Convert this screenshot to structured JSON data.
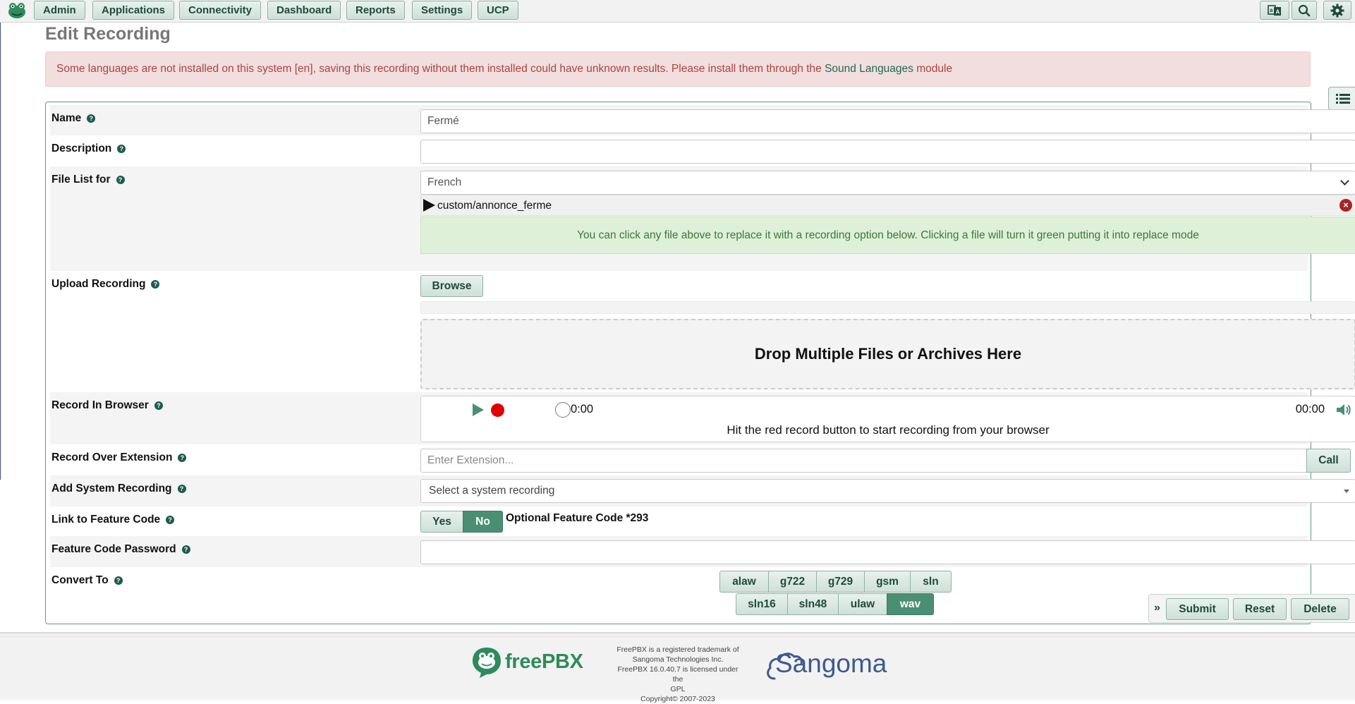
{
  "nav": {
    "items": [
      "Admin",
      "Applications",
      "Connectivity",
      "Dashboard",
      "Reports",
      "Settings",
      "UCP"
    ]
  },
  "icons": {
    "logo": "frog-logo-icon",
    "language": "language-icon",
    "search": "search-icon",
    "settings": "gear-icon",
    "sidebar": "list-icon",
    "help": "question-circle-icon",
    "play": "play-icon",
    "record": "record-icon",
    "volume": "volume-icon",
    "remove": "close-circle-icon"
  },
  "colors": {
    "accent": "#4a8f73",
    "alert_bg": "#f2dede",
    "alert_text": "#a94442",
    "info_bg": "#dff0d8",
    "info_text": "#3c763d",
    "record": "#e00000"
  },
  "page": {
    "title": "Edit Recording"
  },
  "alert": {
    "text": "Some languages are not installed on this system [en], saving this recording without them installed could have unknown results. Please install them through the",
    "link": "Sound Languages",
    "suffix": "module"
  },
  "form": {
    "name": {
      "label": "Name",
      "value": "Fermé"
    },
    "description": {
      "label": "Description",
      "value": ""
    },
    "file_list": {
      "label": "File List for",
      "language": "French",
      "file": "custom/annonce_ferme",
      "info": "You can click any file above to replace it with a recording option below. Clicking a file will turn it green putting it into replace mode"
    },
    "upload": {
      "label": "Upload Recording",
      "browse": "Browse",
      "drop": "Drop Multiple Files or Archives Here"
    },
    "browser": {
      "label": "Record In Browser",
      "position": "0:00",
      "duration": "00:00",
      "hint": "Hit the red record button to start recording from your browser"
    },
    "extension": {
      "label": "Record Over Extension",
      "placeholder": "Enter Extension...",
      "call": "Call"
    },
    "system": {
      "label": "Add System Recording",
      "placeholder": "Select a system recording"
    },
    "feature_code": {
      "label": "Link to Feature Code",
      "yes": "Yes",
      "no": "No",
      "selected": "No",
      "text": "Optional Feature Code *293"
    },
    "password": {
      "label": "Feature Code Password",
      "value": ""
    },
    "convert": {
      "label": "Convert To",
      "formats_row1": [
        "alaw",
        "g722",
        "g729",
        "gsm",
        "sln"
      ],
      "formats_row2": [
        "sln16",
        "sln48",
        "ulaw",
        "wav"
      ],
      "selected": [
        "wav"
      ]
    }
  },
  "actions": {
    "submit": "Submit",
    "reset": "Reset",
    "delete": "Delete"
  },
  "footer": {
    "brand": "freePBX",
    "legal": [
      "FreePBX is a registered trademark of",
      "Sangoma Technologies Inc.",
      "FreePBX 16.0.40.7 is licensed under the",
      "GPL",
      "Copyright© 2007-2023"
    ],
    "partner": "Sangoma"
  }
}
